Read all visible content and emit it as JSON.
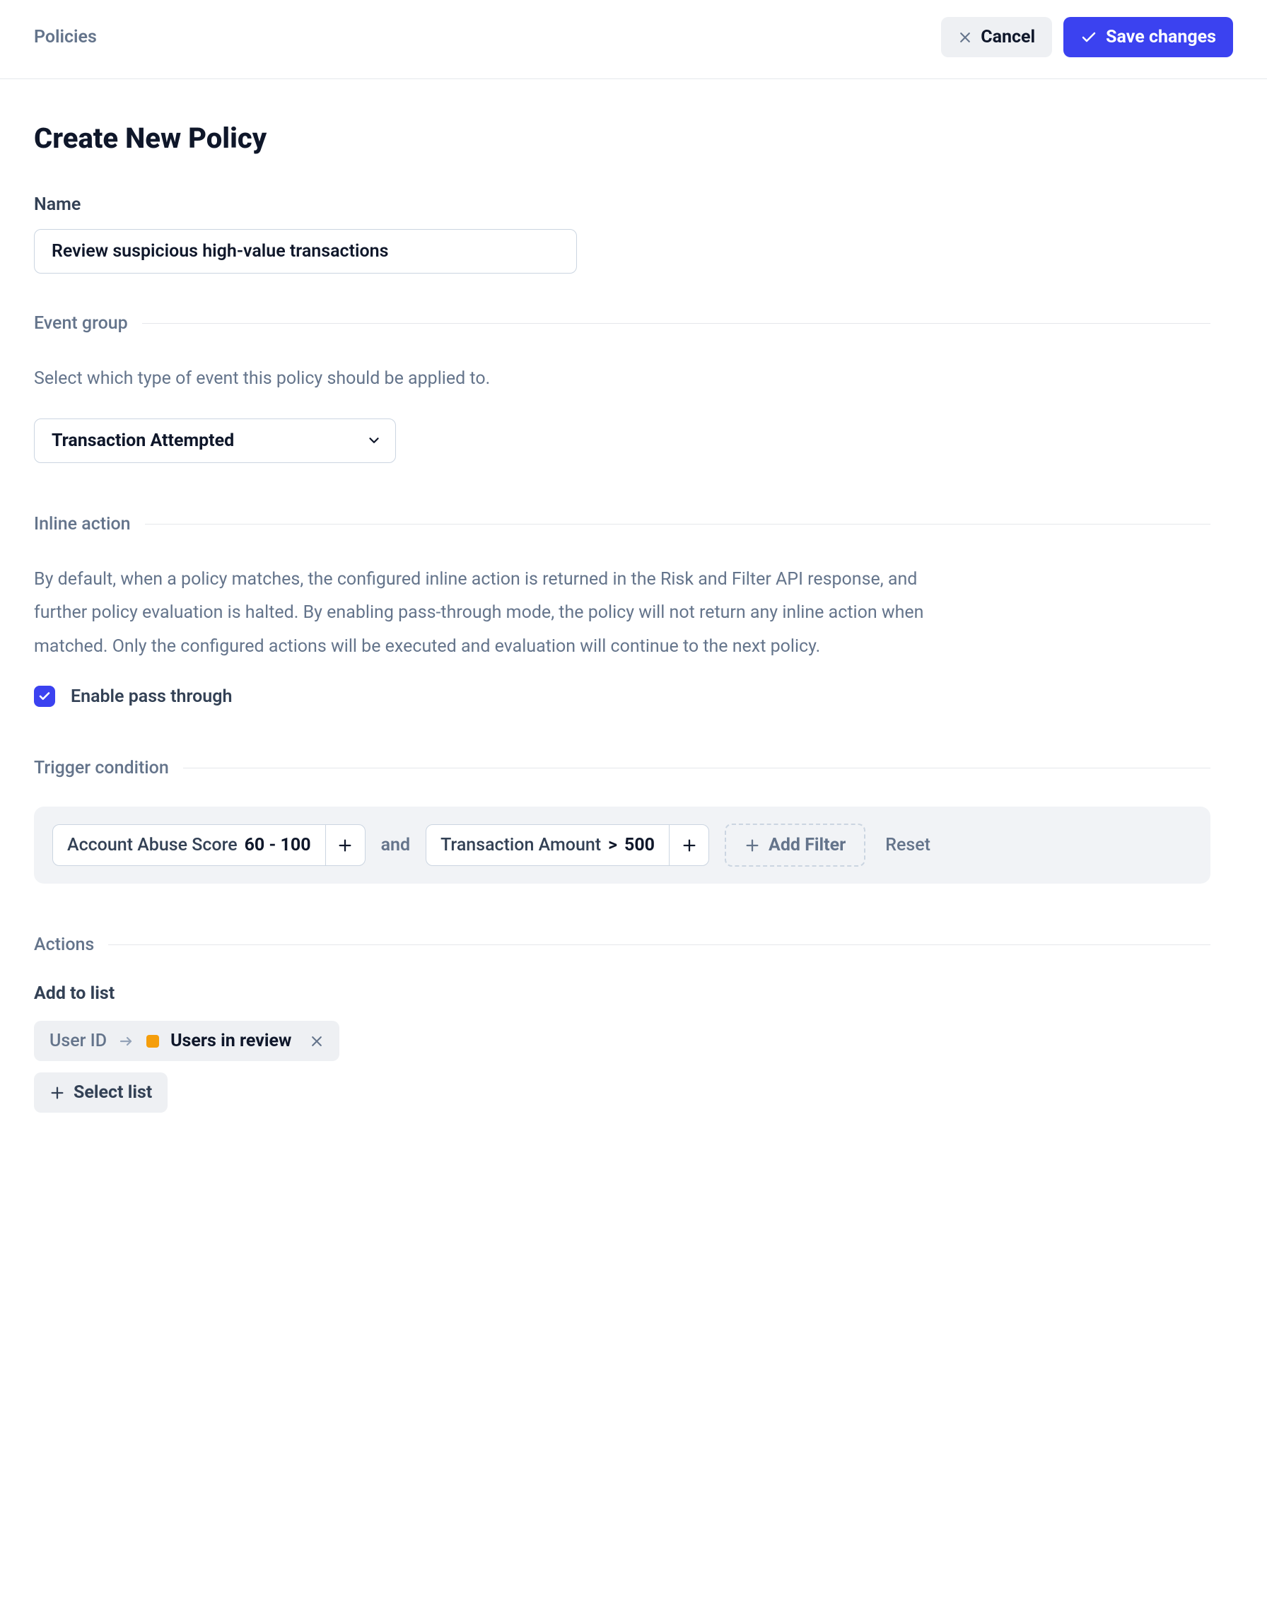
{
  "breadcrumb": "Policies",
  "buttons": {
    "cancel": "Cancel",
    "save": "Save changes"
  },
  "page_title": "Create New Policy",
  "name_field": {
    "label": "Name",
    "value": "Review suspicious high-value transactions"
  },
  "event_group": {
    "header": "Event group",
    "description": "Select which type of event this policy should be applied to.",
    "selected": "Transaction Attempted"
  },
  "inline_action": {
    "header": "Inline action",
    "description": "By default, when a policy matches, the configured inline action is returned in the Risk and Filter API response, and further policy evaluation is halted. By enabling pass-through mode, the policy will not return any inline action when matched. Only the configured actions will be executed and evaluation will continue to the next policy.",
    "checkbox_label": "Enable pass through",
    "checked": true
  },
  "trigger_condition": {
    "header": "Trigger condition",
    "filters": [
      {
        "label": "Account Abuse Score",
        "value": "60 - 100"
      },
      {
        "label": "Transaction Amount",
        "operator": ">",
        "value": "500"
      }
    ],
    "joiner": "and",
    "add_filter": "Add Filter",
    "reset": "Reset"
  },
  "actions": {
    "header": "Actions",
    "add_to_list_label": "Add to list",
    "list_item": {
      "key": "User ID",
      "target": "Users in review"
    },
    "select_list": "Select list"
  }
}
